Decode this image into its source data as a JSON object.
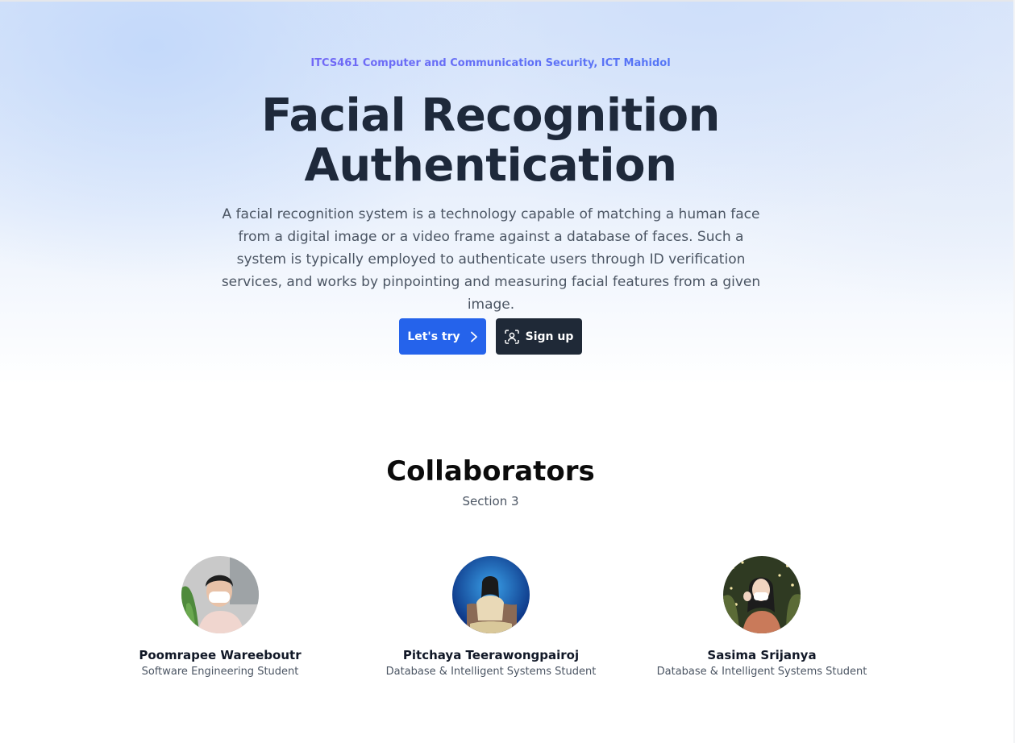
{
  "hero": {
    "course": "ITCS461 Computer and Communication Security, ICT Mahidol",
    "title_line1": "Facial Recognition",
    "title_line2": "Authentication",
    "description": "A facial recognition system is a technology capable of matching a human face from a digital image or a video frame against a database of faces. Such a system is typically employed to authenticate users through ID verification services, and works by pinpointing and measuring facial features from a given image.",
    "try_button": "Let's try",
    "signup_button": "Sign up",
    "accent": "#2563eb",
    "dark": "#1f2937"
  },
  "collaborators": {
    "title": "Collaborators",
    "subtitle": "Section 3",
    "people": [
      {
        "name": "Poomrapee Wareeboutr",
        "role": "Software Engineering Student"
      },
      {
        "name": "Pitchaya Teerawongpairoj",
        "role": "Database & Intelligent Systems Student"
      },
      {
        "name": "Sasima Srijanya",
        "role": "Database & Intelligent Systems Student"
      }
    ]
  },
  "icons": {
    "try": "chevron-right-icon",
    "signup": "face-scan-icon"
  }
}
